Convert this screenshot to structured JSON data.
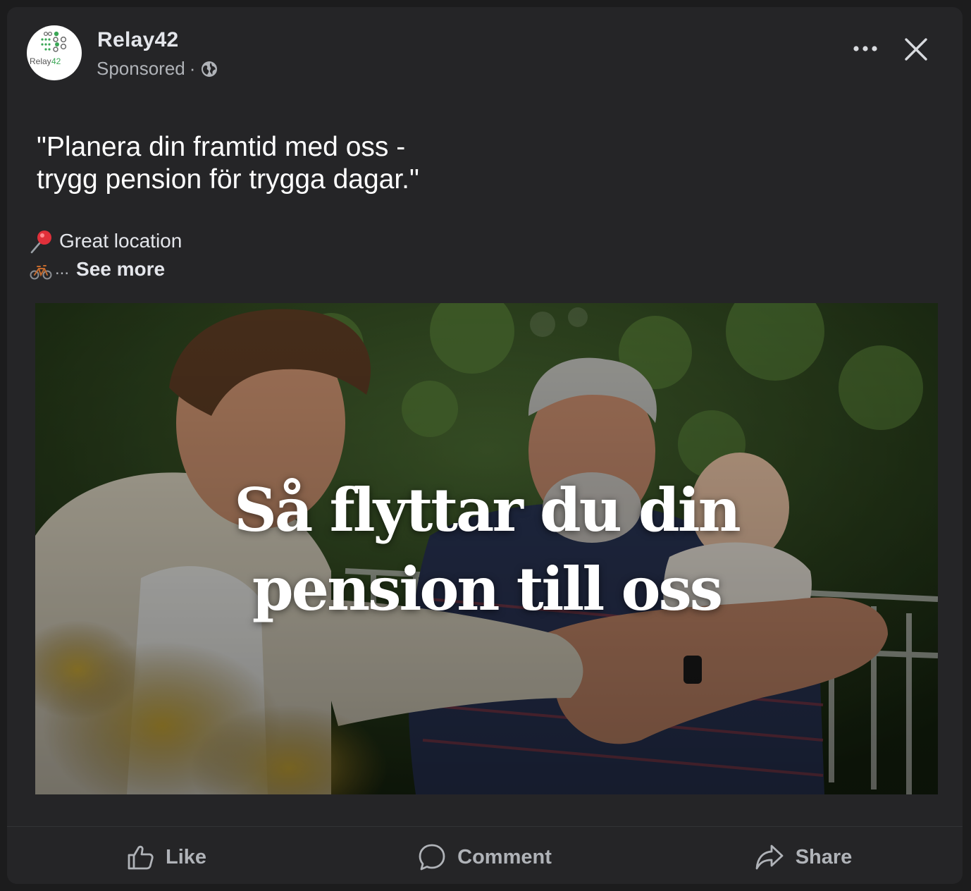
{
  "post": {
    "page_name": "Relay42",
    "sponsored": "Sponsored",
    "separator": "·",
    "avatar_text": "Relay42",
    "text_line1": "\"Planera din framtid med oss -",
    "text_line2": "trygg pension för trygga dagar.\"",
    "location_text": "Great location",
    "ellipsis": "...",
    "see_more": "See more"
  },
  "image": {
    "headline_line1": "Så flyttar du din",
    "headline_line2": "pension till oss"
  },
  "actions": {
    "like": "Like",
    "comment": "Comment",
    "share": "Share"
  },
  "icons": {
    "globe": "globe-icon",
    "more": "more-options-icon",
    "close": "close-icon",
    "pin": "round-pushpin-icon",
    "bike": "bicycle-icon",
    "like": "thumbs-up-icon",
    "comment": "comment-bubble-icon",
    "share": "share-arrow-icon"
  },
  "colors": {
    "card_bg": "#252527",
    "page_bg": "#1c1c1d",
    "primary_text": "#e4e6eb",
    "secondary_text": "#b0b3b8",
    "brand_green": "#3aa655"
  }
}
